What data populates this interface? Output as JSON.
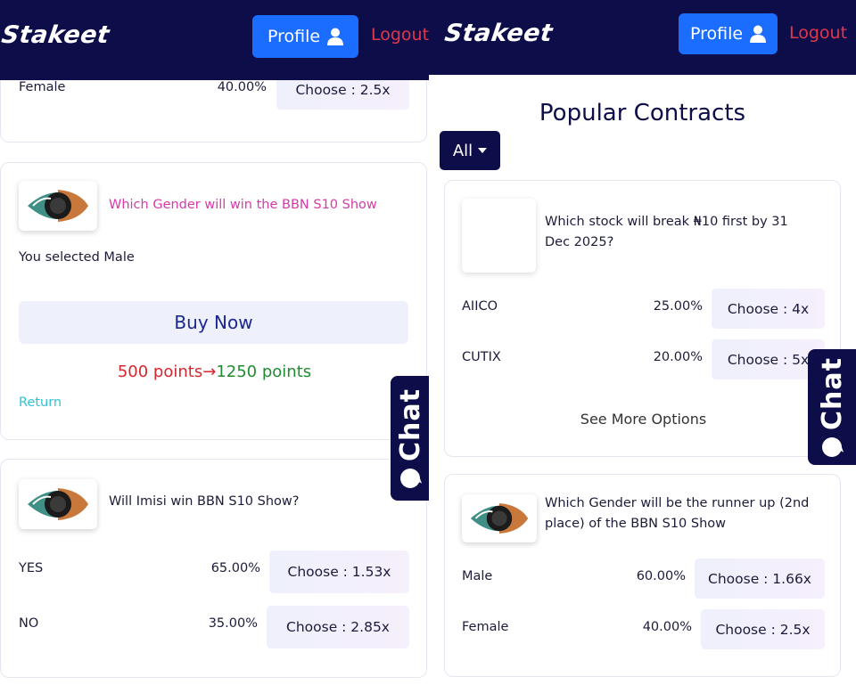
{
  "header": {
    "logo": "Stakeet",
    "profile_label": "Profile",
    "logout_label": "Logout"
  },
  "chat_label": "Chat",
  "left": {
    "top_card": {
      "option": {
        "label": "Female",
        "pct": "40.00%",
        "choose": "Choose : 2.5x"
      }
    },
    "selected_card": {
      "question": "Which Gender will win the BBN S10 Show",
      "selected": "You selected Male",
      "buy_label": "Buy Now",
      "points_from": "500 points",
      "points_arrow": "→",
      "points_to": "1250 points",
      "return_label": "Return"
    },
    "imisi_card": {
      "question": "Will Imisi win BBN S10 Show?",
      "options": [
        {
          "label": "YES",
          "pct": "65.00%",
          "choose": "Choose : 1.53x"
        },
        {
          "label": "NO",
          "pct": "35.00%",
          "choose": "Choose : 2.85x"
        }
      ]
    }
  },
  "right": {
    "title": "Popular Contracts",
    "filter_label": "All",
    "stock_card": {
      "question": "Which stock will break ₦10 first by 31 Dec 2025?",
      "options": [
        {
          "label": "AIICO",
          "pct": "25.00%",
          "choose": "Choose : 4x"
        },
        {
          "label": "CUTIX",
          "pct": "20.00%",
          "choose": "Choose : 5x"
        }
      ],
      "see_more": "See More Options"
    },
    "runner_card": {
      "question": "Which Gender will be the runner up (2nd place) of the BBN S10 Show",
      "options": [
        {
          "label": "Male",
          "pct": "60.00%",
          "choose": "Choose : 1.66x"
        },
        {
          "label": "Female",
          "pct": "40.00%",
          "choose": "Choose : 2.5x"
        }
      ]
    }
  },
  "icons": {
    "profile": "user-icon",
    "filter": "caret-down-icon",
    "chat": "chat-bubble-icon",
    "thumbnail": "eye-logo-image"
  },
  "colors": {
    "navy": "#0d0d4a",
    "blue": "#1a6dff",
    "logout_red": "#e0384b",
    "pink": "#d63aa8",
    "green": "#1f8c2f",
    "cyan": "#2ec2d6"
  }
}
